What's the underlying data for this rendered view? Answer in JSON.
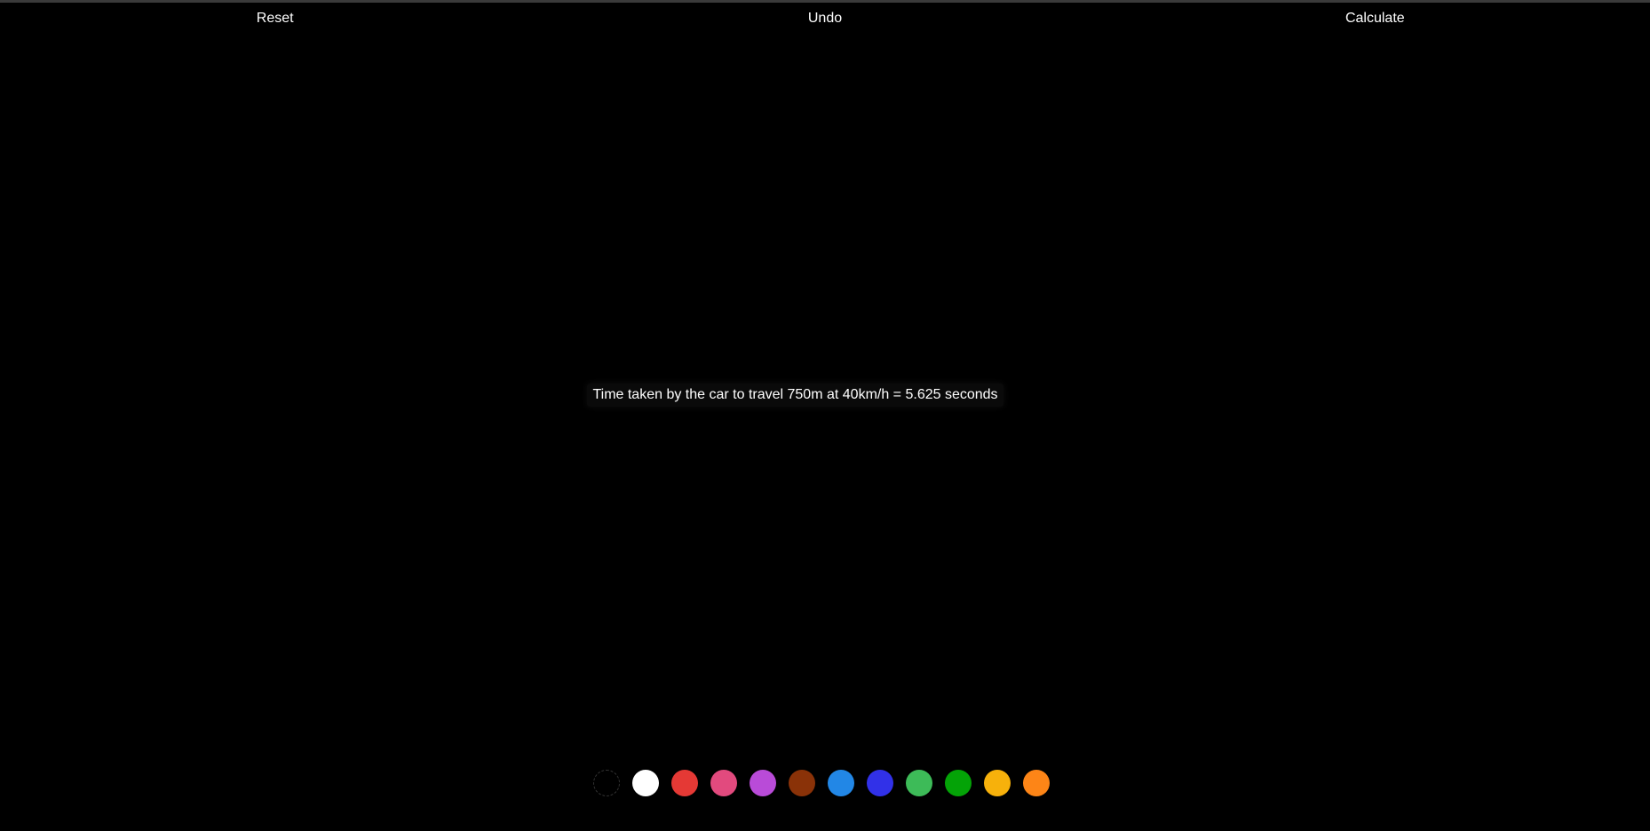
{
  "toolbar": {
    "reset_label": "Reset",
    "undo_label": "Undo",
    "calculate_label": "Calculate"
  },
  "result": {
    "text": "Time taken by the car to travel 750m at 40km/h = 5.625 seconds"
  },
  "palette": {
    "selected_index": 0,
    "colors": [
      {
        "name": "black",
        "hex": "#000000"
      },
      {
        "name": "white",
        "hex": "#ffffff"
      },
      {
        "name": "red",
        "hex": "#e53935"
      },
      {
        "name": "pink",
        "hex": "#e24a7e"
      },
      {
        "name": "purple",
        "hex": "#b94bd8"
      },
      {
        "name": "brown",
        "hex": "#8a3208"
      },
      {
        "name": "light-blue",
        "hex": "#2287e6"
      },
      {
        "name": "blue",
        "hex": "#3131e8"
      },
      {
        "name": "light-green",
        "hex": "#3dbb58"
      },
      {
        "name": "green",
        "hex": "#04a307"
      },
      {
        "name": "yellow",
        "hex": "#f7b10b"
      },
      {
        "name": "orange",
        "hex": "#fd8517"
      }
    ]
  }
}
